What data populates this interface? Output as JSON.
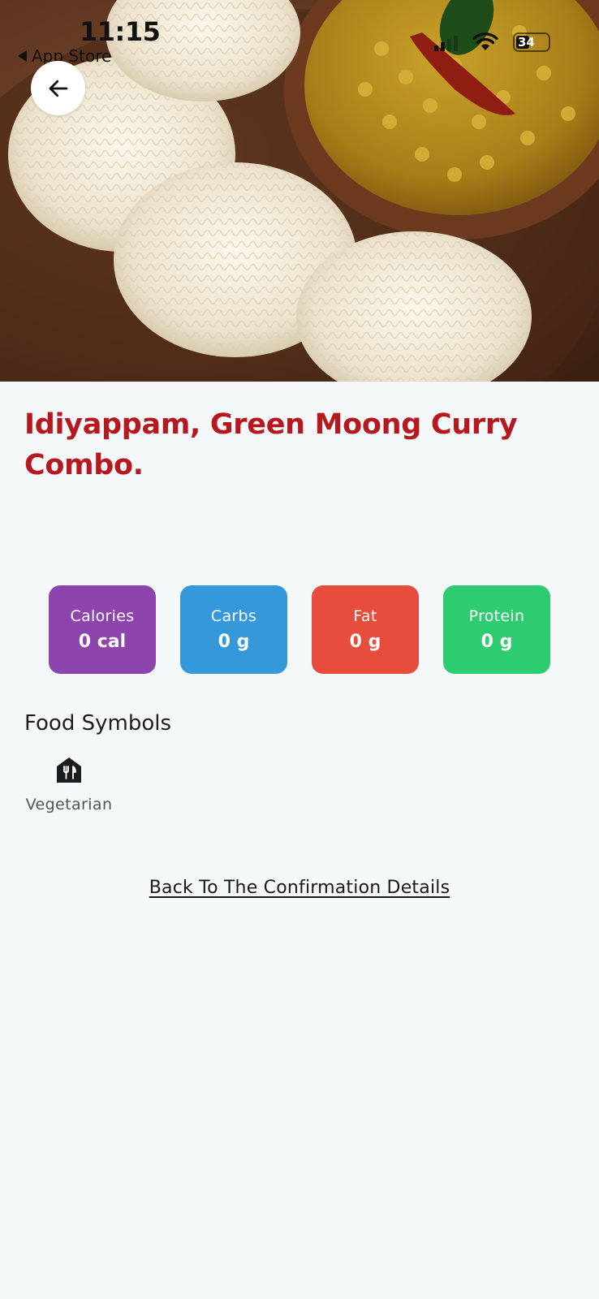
{
  "status_bar": {
    "time": "11:15",
    "back_app_label": "App Store",
    "battery_level": "34"
  },
  "hero": {
    "image_alt": "Idiyappam with green moong curry",
    "icon_back": "arrow-left-icon"
  },
  "dish": {
    "title": "Idiyappam, Green Moong Curry Combo."
  },
  "nutrition": [
    {
      "label": "Calories",
      "value": "0 cal",
      "color": "#8e44ad"
    },
    {
      "label": "Carbs",
      "value": "0 g",
      "color": "#3498db"
    },
    {
      "label": "Fat",
      "value": "0 g",
      "color": "#e74c3c"
    },
    {
      "label": "Protein",
      "value": "0 g",
      "color": "#2ecc71"
    }
  ],
  "food_symbols": {
    "heading": "Food Symbols",
    "items": [
      {
        "label": "Vegetarian",
        "icon": "restaurant-house-icon"
      }
    ]
  },
  "footer": {
    "back_link_label": "Back To The Confirmation Details"
  },
  "colors": {
    "title": "#b5191f",
    "background": "#f4f8f8"
  }
}
